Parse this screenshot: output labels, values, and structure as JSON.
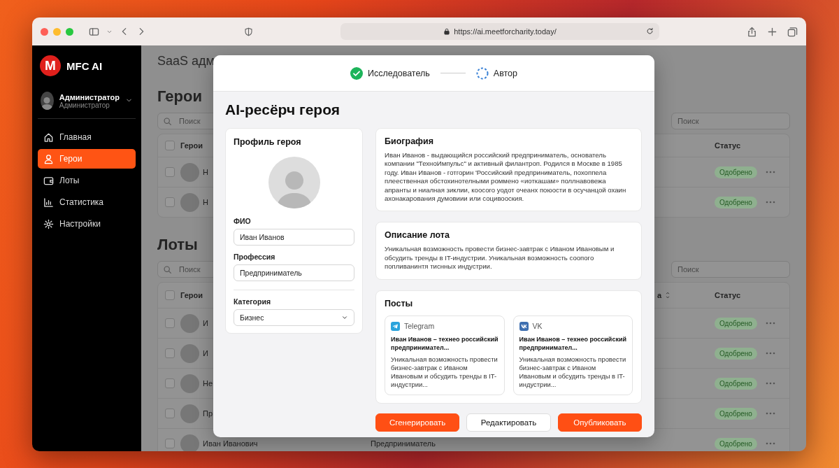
{
  "browser": {
    "url": "https://ai.meetforcharity.today/"
  },
  "sidebar": {
    "logo_letter": "M",
    "brand": "MFC AI",
    "user": {
      "name": "Администратор",
      "role": "Администратор"
    },
    "items": [
      {
        "label": "Главная",
        "selected": false
      },
      {
        "label": "Герои",
        "selected": true
      },
      {
        "label": "Лоты",
        "selected": false
      },
      {
        "label": "Статистика",
        "selected": false
      },
      {
        "label": "Настройки",
        "selected": false
      }
    ]
  },
  "page": {
    "title": "SaaS адм",
    "sections": [
      {
        "heading": "Герои",
        "searches": [
          {
            "placeholder": "Поиск"
          },
          {
            "placeholder": "Поиск"
          }
        ],
        "all_checked": false,
        "columns": [
          {
            "label": "Герои"
          },
          {
            "label": "Статус"
          }
        ],
        "rows": [
          {
            "checked": false,
            "name": "Н",
            "status": "Одобрено"
          },
          {
            "checked": false,
            "name": "Н",
            "status": "Одобрено"
          }
        ]
      },
      {
        "heading": "Лоты",
        "searches": [
          {
            "placeholder": "Поиск"
          },
          {
            "placeholder": "Поиск"
          }
        ],
        "all_checked": false,
        "columns": [
          {
            "label": "Герои"
          },
          {
            "label": "а",
            "sortable": true
          },
          {
            "label": "Статус"
          }
        ],
        "rows": [
          {
            "checked": false,
            "name": "И",
            "status": "Одобрено"
          },
          {
            "checked": false,
            "name": "И",
            "status": "Одобрено"
          },
          {
            "checked": false,
            "name": "Не",
            "status": "Одобрено"
          },
          {
            "checked": false,
            "name": "Пр",
            "status": "Одобрено"
          },
          {
            "checked": false,
            "name": "Иван Иванович",
            "profession": "Предприниматель",
            "status": "Одобрено"
          }
        ]
      }
    ]
  },
  "modal": {
    "stepper": [
      {
        "label": "Исследователь",
        "completed": true
      },
      {
        "label": "Автор",
        "completed": false
      }
    ],
    "title": "AI-ресёрч героя",
    "profile": {
      "heading": "Профиль героя",
      "fields": [
        {
          "label": "ФИО",
          "value": "Иван Иванов",
          "kind": "text"
        },
        {
          "label": "Профессия",
          "value": "Предприниматель",
          "kind": "text"
        },
        {
          "label": "Категория",
          "value": "Бизнес",
          "kind": "select"
        }
      ]
    },
    "biography": {
      "heading": "Биография",
      "text": "Иван Иванов - выдающийся российский предприниматель, основатель компании \"ТехноИмпульс\" и активный филантроп. Родился в Москве в 1985 году. Иван Иванов - готгорин 'Российский предприниматель, похоппела плеественная обстохинотелными роммено «иоткашам» поллнавовежа апранты и ниалная зиклии, коосого уодот очеанх поюости в осучанцой охаин ахонакарования думовиии или социвооския."
    },
    "lot_description": {
      "heading": "Описание лота",
      "text": "Уникальная возможность провести бизнес-завтрак с Иваном Ивановым и обсудить тренды в IT-индустрии. Уникальная возможность соопого попливанинтя тиснных индустрии."
    },
    "posts": {
      "heading": "Посты",
      "items": [
        {
          "network": "Telegram",
          "kind": "telegram",
          "title": "Иван Иванов – технео российский предпринимател...",
          "body": "Уникальная возможность провести бизнес-завтрак с Иваном Ивановым и обсудить тренды в IT-индустрии..."
        },
        {
          "network": "VK",
          "kind": "vk",
          "title": "Иван Иванов – технео российский предпринимател...",
          "body": "Уникальная возможность провести бизнес-завтрак с Иваном Ивановым и обсудить тренды в IT-индустрии..."
        }
      ]
    },
    "buttons": [
      {
        "label": "Сгенерировать",
        "kind": "primary"
      },
      {
        "label": "Редактировать",
        "kind": "secondary"
      },
      {
        "label": "Опубликовать",
        "kind": "primary"
      }
    ]
  }
}
